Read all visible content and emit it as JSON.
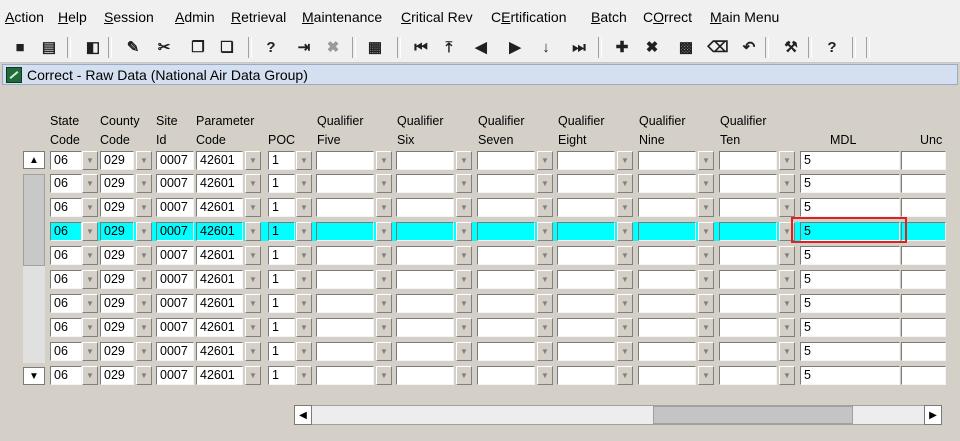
{
  "menu": [
    {
      "pre": "",
      "u": "A",
      "post": "ction"
    },
    {
      "pre": "",
      "u": "H",
      "post": "elp"
    },
    {
      "pre": "",
      "u": "S",
      "post": "ession"
    },
    {
      "pre": "",
      "u": "A",
      "post": "dmin"
    },
    {
      "pre": "",
      "u": "R",
      "post": "etrieval"
    },
    {
      "pre": "",
      "u": "M",
      "post": "aintenance"
    },
    {
      "pre": "",
      "u": "C",
      "post": "ritical Rev"
    },
    {
      "pre": "C",
      "u": "E",
      "post": "rtification"
    },
    {
      "pre": "",
      "u": "B",
      "post": "atch"
    },
    {
      "pre": "C",
      "u": "O",
      "post": "rrect"
    },
    {
      "pre": "",
      "u": "M",
      "post": "ain Menu"
    }
  ],
  "toolbar_icons": [
    "save-icon",
    "print-icon",
    "exit-icon",
    "edit-icon",
    "cut-icon",
    "copy-icon",
    "paste-icon",
    "query-icon",
    "execute-query-icon",
    "cancel-query-icon",
    "calculator-icon",
    "first-record-icon",
    "top-icon",
    "previous-record-icon",
    "next-record-icon",
    "down-icon",
    "last-record-icon",
    "insert-record-icon",
    "delete-record-icon",
    "duplicate-record-icon",
    "clear-record-icon",
    "undo-icon",
    "tools-icon",
    "help-icon"
  ],
  "toolbar_glyphs": {
    "help": "?"
  },
  "window_title": "Correct - Raw Data (National Air Data Group)",
  "columns": {
    "state": [
      "State",
      "Code"
    ],
    "county": [
      "County",
      "Code"
    ],
    "site": [
      "Site",
      "Id"
    ],
    "parameter": [
      "Parameter",
      "Code"
    ],
    "poc": [
      "",
      "POC"
    ],
    "q5": [
      "Qualifier",
      "Five"
    ],
    "q6": [
      "Qualifier",
      "Six"
    ],
    "q7": [
      "Qualifier",
      "Seven"
    ],
    "q8": [
      "Qualifier",
      "Eight"
    ],
    "q9": [
      "Qualifier",
      "Nine"
    ],
    "q10": [
      "Qualifier",
      "Ten"
    ],
    "mdl": [
      "",
      "MDL"
    ],
    "unc": [
      "",
      "Unc"
    ]
  },
  "rows": [
    {
      "state": "06",
      "county": "029",
      "site": "0007",
      "parameter": "42601",
      "poc": "1",
      "mdl": "5"
    },
    {
      "state": "06",
      "county": "029",
      "site": "0007",
      "parameter": "42601",
      "poc": "1",
      "mdl": "5"
    },
    {
      "state": "06",
      "county": "029",
      "site": "0007",
      "parameter": "42601",
      "poc": "1",
      "mdl": "5"
    },
    {
      "state": "06",
      "county": "029",
      "site": "0007",
      "parameter": "42601",
      "poc": "1",
      "mdl": "5"
    },
    {
      "state": "06",
      "county": "029",
      "site": "0007",
      "parameter": "42601",
      "poc": "1",
      "mdl": "5"
    },
    {
      "state": "06",
      "county": "029",
      "site": "0007",
      "parameter": "42601",
      "poc": "1",
      "mdl": "5"
    },
    {
      "state": "06",
      "county": "029",
      "site": "0007",
      "parameter": "42601",
      "poc": "1",
      "mdl": "5"
    },
    {
      "state": "06",
      "county": "029",
      "site": "0007",
      "parameter": "42601",
      "poc": "1",
      "mdl": "5"
    },
    {
      "state": "06",
      "county": "029",
      "site": "0007",
      "parameter": "42601",
      "poc": "1",
      "mdl": "5"
    },
    {
      "state": "06",
      "county": "029",
      "site": "0007",
      "parameter": "42601",
      "poc": "1",
      "mdl": "5"
    }
  ],
  "selected_row": 3,
  "highlight_color": "#00ffff",
  "focus_outline_color": "#e02020"
}
